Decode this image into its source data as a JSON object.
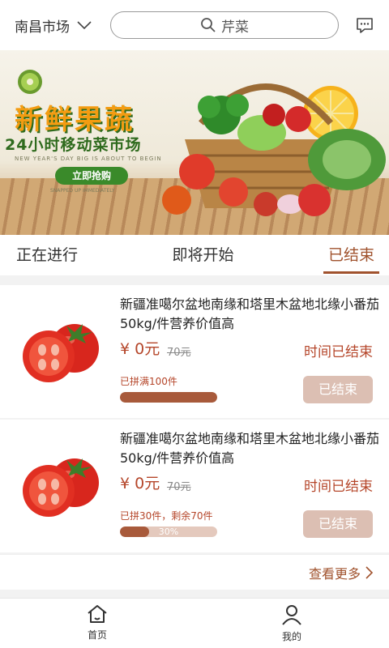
{
  "header": {
    "city": "南昌市场",
    "search_value": "芹菜"
  },
  "banner": {
    "title": "新鲜果蔬",
    "subtitle": "24小时移动菜市场",
    "english_line": "NEW YEAR'S DAY BIG IS ABOUT TO BEGIN",
    "cta": "立即抢购",
    "english_line2": "SNAPPED UP IMMEDIATELY"
  },
  "tabs": [
    {
      "label": "正在进行"
    },
    {
      "label": "即将开始"
    },
    {
      "label": "已结束"
    }
  ],
  "active_tab": 2,
  "products": [
    {
      "name": "新疆准噶尔盆地南缘和塔里木盆地北缘小番茄50kg/件营养价值高",
      "price": "¥ 0元",
      "old_price": "70元",
      "time_status": "时间已结束",
      "sold_text": "已拼满100件",
      "progress": 1.0,
      "progress_label": "",
      "button": "已结束"
    },
    {
      "name": "新疆准噶尔盆地南缘和塔里木盆地北缘小番茄50kg/件营养价值高",
      "price": "¥ 0元",
      "old_price": "70元",
      "time_status": "时间已结束",
      "sold_text": "已拼30件，剩余70件",
      "progress": 0.3,
      "progress_label": "30%",
      "button": "已结束"
    }
  ],
  "more_label": "查看更多",
  "bottom_nav": [
    {
      "label": "首页",
      "icon": "home-icon"
    },
    {
      "label": "我的",
      "icon": "user-icon"
    }
  ],
  "colors": {
    "accent": "#a0522d",
    "price": "#b5462a",
    "button_disabled": "#dcbfb3"
  }
}
